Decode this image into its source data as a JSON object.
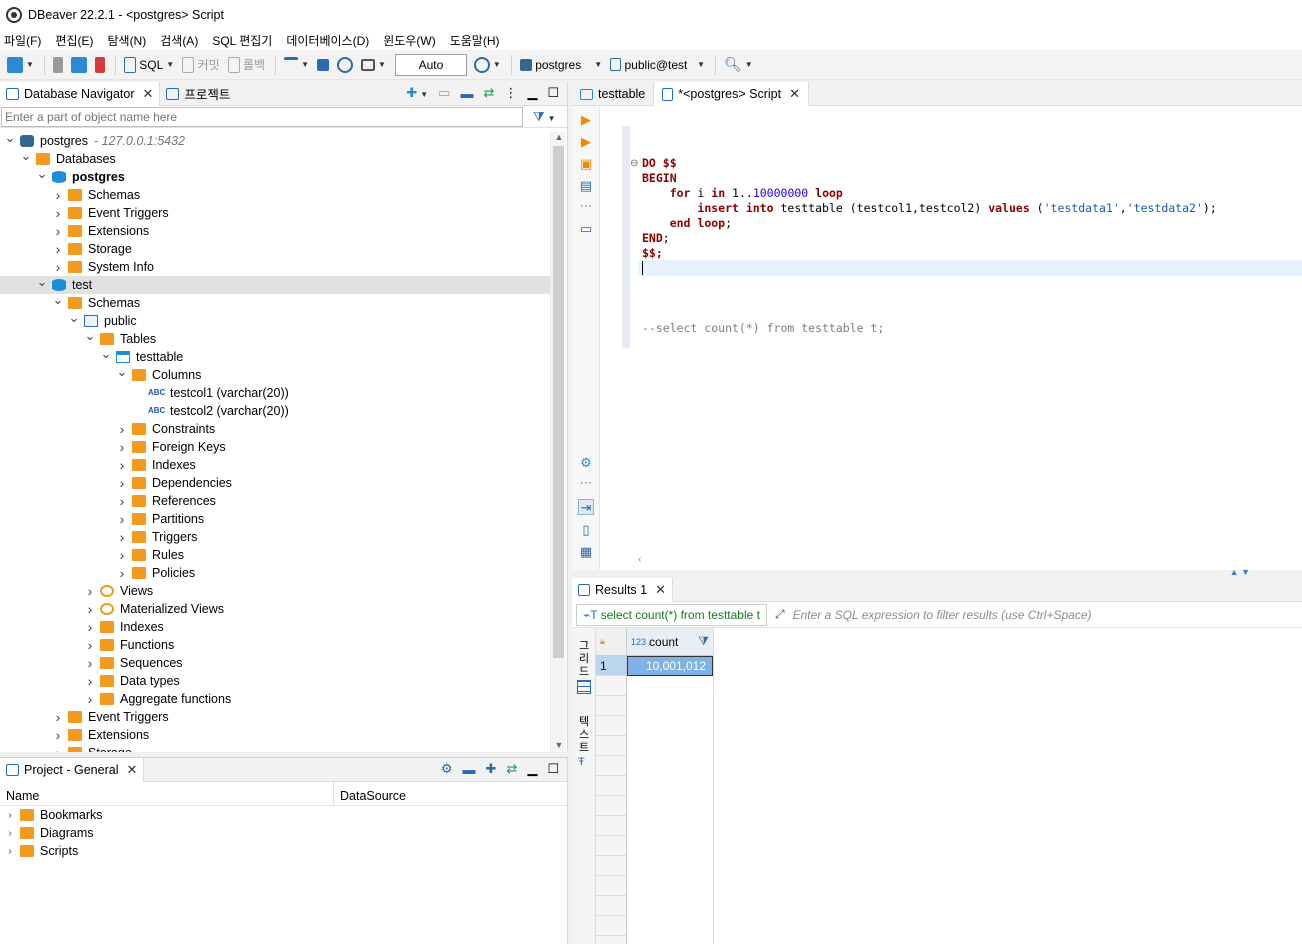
{
  "window": {
    "title": "DBeaver 22.2.1 - <postgres> Script"
  },
  "menu": [
    "파일(F)",
    "편집(E)",
    "탐색(N)",
    "검색(A)",
    "SQL 편집기",
    "데이터베이스(D)",
    "윈도우(W)",
    "도움말(H)"
  ],
  "toolbar": {
    "sql_label": "SQL",
    "commit_label": "커밋",
    "rollback_label": "롤백",
    "tx_mode": "Auto",
    "datasource": "postgres",
    "schema": "public@test"
  },
  "navigator": {
    "tab_label": "Database Navigator",
    "projects_tab_label": "프로젝트",
    "filter_placeholder": "Enter a part of object name here",
    "connection": {
      "name": "postgres",
      "address": "- 127.0.0.1:5432"
    },
    "tree": [
      {
        "depth": 0,
        "exp": "v",
        "icon": "pg",
        "label": "postgres",
        "suffix": "- 127.0.0.1:5432"
      },
      {
        "depth": 1,
        "exp": "v",
        "icon": "folder",
        "label": "Databases"
      },
      {
        "depth": 2,
        "exp": "v",
        "icon": "db",
        "label": "postgres",
        "bold": true
      },
      {
        "depth": 3,
        "exp": ">",
        "icon": "folder",
        "label": "Schemas"
      },
      {
        "depth": 3,
        "exp": ">",
        "icon": "folder",
        "label": "Event Triggers"
      },
      {
        "depth": 3,
        "exp": ">",
        "icon": "folder",
        "label": "Extensions"
      },
      {
        "depth": 3,
        "exp": ">",
        "icon": "folder",
        "label": "Storage"
      },
      {
        "depth": 3,
        "exp": ">",
        "icon": "folder",
        "label": "System Info"
      },
      {
        "depth": 2,
        "exp": "v",
        "icon": "db",
        "label": "test",
        "selected": true
      },
      {
        "depth": 3,
        "exp": "v",
        "icon": "folder",
        "label": "Schemas"
      },
      {
        "depth": 4,
        "exp": "v",
        "icon": "schema",
        "label": "public"
      },
      {
        "depth": 5,
        "exp": "v",
        "icon": "folder",
        "label": "Tables"
      },
      {
        "depth": 6,
        "exp": "v",
        "icon": "table",
        "label": "testtable"
      },
      {
        "depth": 7,
        "exp": "v",
        "icon": "folder",
        "label": "Columns"
      },
      {
        "depth": 8,
        "exp": "",
        "icon": "abc",
        "label": "testcol1 (varchar(20))"
      },
      {
        "depth": 8,
        "exp": "",
        "icon": "abc",
        "label": "testcol2 (varchar(20))"
      },
      {
        "depth": 7,
        "exp": ">",
        "icon": "folder",
        "label": "Constraints"
      },
      {
        "depth": 7,
        "exp": ">",
        "icon": "folder",
        "label": "Foreign Keys"
      },
      {
        "depth": 7,
        "exp": ">",
        "icon": "folder",
        "label": "Indexes"
      },
      {
        "depth": 7,
        "exp": ">",
        "icon": "folder",
        "label": "Dependencies"
      },
      {
        "depth": 7,
        "exp": ">",
        "icon": "folder",
        "label": "References"
      },
      {
        "depth": 7,
        "exp": ">",
        "icon": "folder",
        "label": "Partitions"
      },
      {
        "depth": 7,
        "exp": ">",
        "icon": "folder",
        "label": "Triggers"
      },
      {
        "depth": 7,
        "exp": ">",
        "icon": "folder",
        "label": "Rules"
      },
      {
        "depth": 7,
        "exp": ">",
        "icon": "folder",
        "label": "Policies"
      },
      {
        "depth": 5,
        "exp": ">",
        "icon": "eye",
        "label": "Views"
      },
      {
        "depth": 5,
        "exp": ">",
        "icon": "eye",
        "label": "Materialized Views"
      },
      {
        "depth": 5,
        "exp": ">",
        "icon": "folder",
        "label": "Indexes"
      },
      {
        "depth": 5,
        "exp": ">",
        "icon": "folder",
        "label": "Functions"
      },
      {
        "depth": 5,
        "exp": ">",
        "icon": "folder",
        "label": "Sequences"
      },
      {
        "depth": 5,
        "exp": ">",
        "icon": "folder",
        "label": "Data types"
      },
      {
        "depth": 5,
        "exp": ">",
        "icon": "folder",
        "label": "Aggregate functions"
      },
      {
        "depth": 3,
        "exp": ">",
        "icon": "folder",
        "label": "Event Triggers"
      },
      {
        "depth": 3,
        "exp": ">",
        "icon": "folder",
        "label": "Extensions"
      },
      {
        "depth": 3,
        "exp": ">",
        "icon": "folder",
        "label": "Storage"
      }
    ]
  },
  "project": {
    "tab_label": "Project - General",
    "col_name": "Name",
    "col_datasource": "DataSource",
    "items": [
      "Bookmarks",
      "Diagrams",
      "Scripts"
    ]
  },
  "editor": {
    "tabs": [
      {
        "label": "testtable",
        "active": false
      },
      {
        "label": "*<postgres> Script",
        "active": true
      }
    ],
    "code_lines": [
      "DO $$",
      "BEGIN",
      "    for i in 1..10000000 loop",
      "        insert into testtable (testcol1,testcol2) values ('testdata1','testdata2');",
      "    end loop;",
      "END;",
      "$$;",
      "",
      "",
      "",
      "",
      "--select count(*) from testtable t;"
    ]
  },
  "results": {
    "tab_label": "Results 1",
    "query_label": "select count(*) from testtable t",
    "filter_placeholder": "Enter a SQL expression to filter results (use Ctrl+Space)",
    "side_grid_label": "그리드",
    "side_text_label": "텍스트",
    "columns": [
      {
        "type": "123",
        "name": "count"
      }
    ],
    "rows": [
      {
        "num": "1",
        "values": [
          "10,001,012"
        ]
      }
    ]
  },
  "colors": {
    "accent": "#1e8fd6",
    "folder": "#f29b1f",
    "keyword": "#8b0000",
    "selection": "#7fb3e8"
  }
}
